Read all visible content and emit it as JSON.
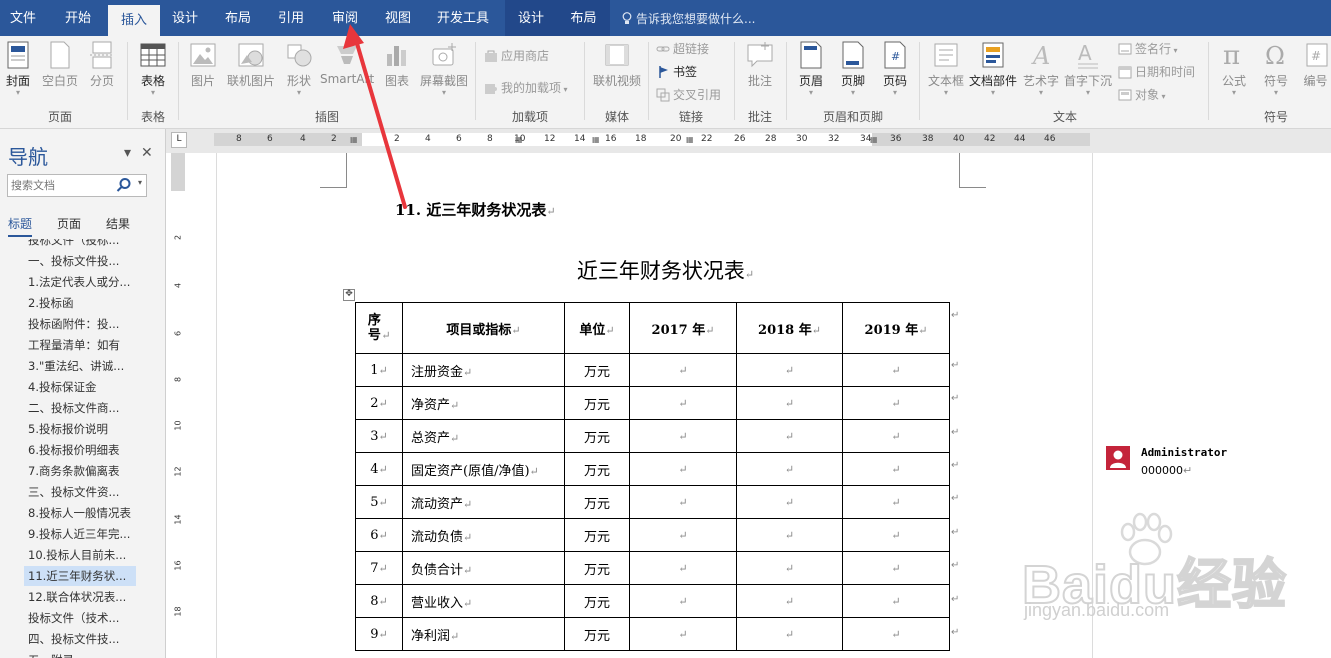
{
  "ribbon_tabs": [
    {
      "label": "文件",
      "active": false
    },
    {
      "label": "开始",
      "active": false
    },
    {
      "label": "插入",
      "active": true
    },
    {
      "label": "设计",
      "active": false
    },
    {
      "label": "布局",
      "active": false
    },
    {
      "label": "引用",
      "active": false
    },
    {
      "label": "审阅",
      "active": false
    },
    {
      "label": "视图",
      "active": false
    },
    {
      "label": "开发工具",
      "active": false
    }
  ],
  "context_tabs": [
    "设计",
    "布局"
  ],
  "tell_me": "告诉我您想要做什么...",
  "ribbon": {
    "cover": "封面",
    "blank_page": "空白页",
    "page_break": "分页",
    "table": "表格",
    "picture": "图片",
    "online_picture": "联机图片",
    "shapes": "形状",
    "smartart": "SmartArt",
    "chart": "图表",
    "screenshot": "屏幕截图",
    "store": "应用商店",
    "my_addins": "我的加载项",
    "online_video": "联机视频",
    "hyperlink": "超链接",
    "bookmark": "书签",
    "cross_ref": "交叉引用",
    "comment": "批注",
    "header": "页眉",
    "footer": "页脚",
    "page_number": "页码",
    "text_box": "文本框",
    "quick_parts": "文档部件",
    "wordart": "艺术字",
    "drop_cap": "首字下沉",
    "signature_line": "签名行",
    "date_time": "日期和时间",
    "object": "对象",
    "equation": "公式",
    "symbol": "符号",
    "numbering": "编号",
    "groups": {
      "pages": "页面",
      "tables": "表格",
      "illustrations": "插图",
      "addins": "加载项",
      "media": "媒体",
      "links": "链接",
      "comments": "批注",
      "header_footer": "页眉和页脚",
      "text": "文本",
      "symbols": "符号"
    }
  },
  "hruler_labels": [
    "8",
    "6",
    "4",
    "2",
    "2",
    "4",
    "6",
    "8",
    "10",
    "12",
    "14",
    "16",
    "18",
    "20",
    "22",
    "26",
    "28",
    "30",
    "32",
    "34",
    "36",
    "38",
    "40",
    "42",
    "44",
    "46"
  ],
  "vruler_labels": [
    "2",
    "4",
    "6",
    "8",
    "10",
    "12",
    "14",
    "16",
    "18"
  ],
  "nav": {
    "title": "导航",
    "search_placeholder": "搜索文档",
    "tabs": [
      "标题",
      "页面",
      "结果"
    ],
    "items": [
      "投标文件（投标...",
      "一、投标文件投...",
      "1.法定代表人或分...",
      "2.投标函",
      "投标函附件：投...",
      "工程量清单：如有",
      "3.\"重法纪、讲诚...",
      "4.投标保证金",
      "二、投标文件商...",
      "5.投标报价说明",
      "6.投标报价明细表",
      "7.商务条款偏离表",
      "三、投标文件资...",
      "8.投标人一般情况表",
      "9.投标人近三年完...",
      "10.投标人目前未...",
      "11.近三年财务状...",
      "12.联合体状况表...",
      "投标文件（技术...",
      "四、投标文件技...",
      "五、附录..."
    ],
    "selected_index": 16
  },
  "document": {
    "heading": "11. 近三年财务状况表",
    "title": "近三年财务状况表",
    "table": {
      "headers": [
        "序号",
        "项目或指标",
        "单位",
        "2017 年",
        "2018 年",
        "2019 年"
      ],
      "rows": [
        [
          "1",
          "注册资金",
          "万元"
        ],
        [
          "2",
          "净资产",
          "万元"
        ],
        [
          "3",
          "总资产",
          "万元"
        ],
        [
          "4",
          "固定资产(原值/净值)",
          "万元"
        ],
        [
          "5",
          "流动资产",
          "万元"
        ],
        [
          "6",
          "流动负债",
          "万元"
        ],
        [
          "7",
          "负债合计",
          "万元"
        ],
        [
          "8",
          "营业收入",
          "万元"
        ],
        [
          "9",
          "净利润",
          "万元"
        ]
      ]
    }
  },
  "comment": {
    "author": "Administrator",
    "text": "000000"
  },
  "watermark": {
    "brand": "Baidu经验",
    "url": "jingyan.baidu.com"
  },
  "colors": {
    "title_bar": "#2b579a",
    "context_bar": "#22488a",
    "arrow": "#e8363c",
    "nav_selected": "#cde0f7"
  }
}
